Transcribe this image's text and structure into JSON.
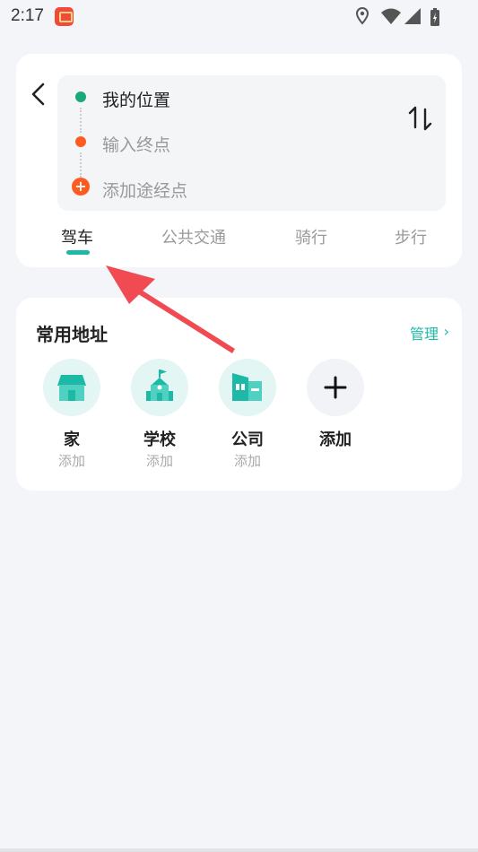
{
  "status_bar": {
    "time": "2:17"
  },
  "route": {
    "start": "我的位置",
    "destination_placeholder": "输入终点",
    "waypoint_placeholder": "添加途经点"
  },
  "modes": [
    {
      "label": "驾车",
      "active": true
    },
    {
      "label": "公共交通",
      "active": false
    },
    {
      "label": "骑行",
      "active": false
    },
    {
      "label": "步行",
      "active": false
    }
  ],
  "common_addresses": {
    "title": "常用地址",
    "manage_label": "管理",
    "items": [
      {
        "name": "家",
        "sub": "添加",
        "icon": "home-icon"
      },
      {
        "name": "学校",
        "sub": "添加",
        "icon": "school-icon"
      },
      {
        "name": "公司",
        "sub": "添加",
        "icon": "office-building-icon"
      },
      {
        "name": "添加",
        "sub": "",
        "icon": "plus-icon"
      }
    ]
  },
  "colors": {
    "accent": "#1bb9a6",
    "start_dot": "#1aa87a",
    "end_dot": "#ff5a1f",
    "annotation_arrow": "#f04b53"
  }
}
